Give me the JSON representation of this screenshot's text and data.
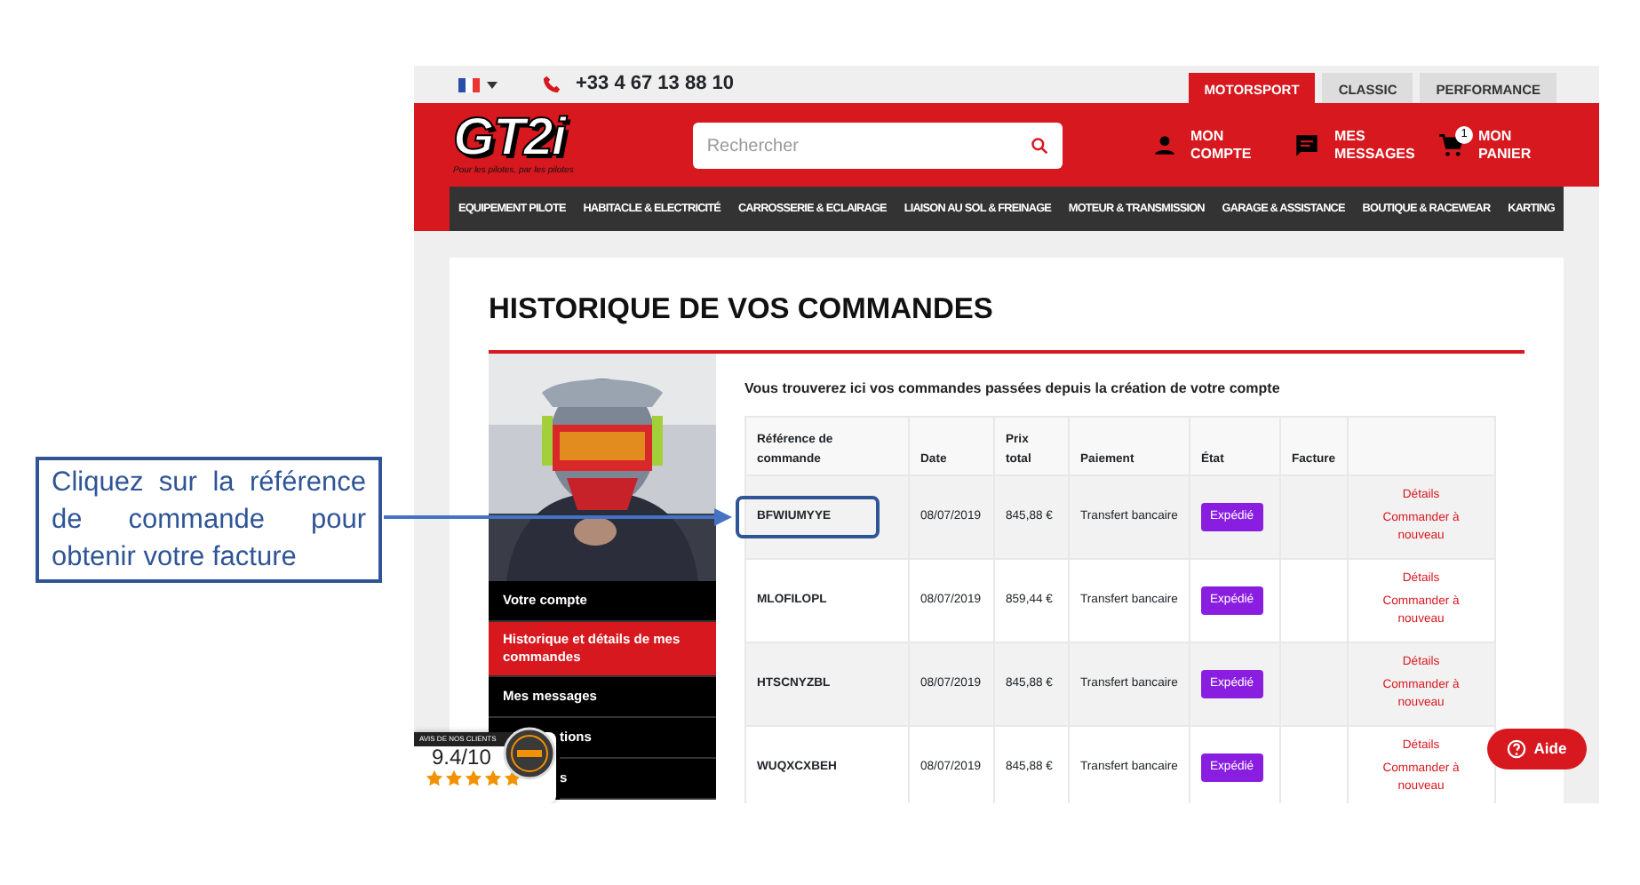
{
  "annotation": {
    "callout": "Cliquez sur la référence de commande pour obtenir votre facture"
  },
  "topbar": {
    "phone": "+33 4 67 13 88 10",
    "universes": [
      {
        "label": "MOTORSPORT",
        "selected": true
      },
      {
        "label": "CLASSIC",
        "selected": false
      },
      {
        "label": "PERFORMANCE",
        "selected": false
      }
    ]
  },
  "header": {
    "logo": "GT2i",
    "tagline": "Pour les pilotes, par les pilotes",
    "search": {
      "placeholder": "Rechercher"
    },
    "actions": [
      {
        "kind": "account",
        "label": "MON COMPTE"
      },
      {
        "kind": "messages",
        "label": "MES MESSAGES"
      },
      {
        "kind": "cart",
        "label": "MON PANIER",
        "badge": "1"
      }
    ]
  },
  "nav": [
    "EQUIPEMENT PILOTE",
    "HABITACLE & ELECTRICITÉ",
    "CARROSSERIE & ECLAIRAGE",
    "LIAISON AU SOL & FREINAGE",
    "MOTEUR & TRANSMISSION",
    "GARAGE & ASSISTANCE",
    "BOUTIQUE & RACEWEAR",
    "KARTING"
  ],
  "page": {
    "title": "HISTORIQUE DE VOS COMMANDES",
    "intro": "Vous trouverez ici vos commandes passées depuis la création de votre compte",
    "menu": [
      {
        "label": "Votre compte",
        "selected": false
      },
      {
        "label": "Historique et détails de mes commandes",
        "selected": true
      },
      {
        "label": "Mes messages",
        "selected": false
      },
      {
        "label": "tions",
        "selected": false
      },
      {
        "label": "s",
        "selected": false
      }
    ],
    "table": {
      "columns": [
        "Référence de commande",
        "Date",
        "Prix total",
        "Paiement",
        "État",
        "Facture"
      ],
      "rows": [
        {
          "reference": "BFWIUMYYE",
          "date": "08/07/2019",
          "total": "845,88 €",
          "payment": "Transfert bancaire",
          "status": "Expédié",
          "actions": [
            "Détails",
            "Commander à nouveau"
          ],
          "highlighted": true
        },
        {
          "reference": "MLOFILOPL",
          "date": "08/07/2019",
          "total": "859,44 €",
          "payment": "Transfert bancaire",
          "status": "Expédié",
          "actions": [
            "Détails",
            "Commander à nouveau"
          ],
          "highlighted": false
        },
        {
          "reference": "HTSCNYZBL",
          "date": "08/07/2019",
          "total": "845,88 €",
          "payment": "Transfert bancaire",
          "status": "Expédié",
          "actions": [
            "Détails",
            "Commander à nouveau"
          ],
          "highlighted": false
        },
        {
          "reference": "WUQXCXBEH",
          "date": "08/07/2019",
          "total": "845,88 €",
          "payment": "Transfert bancaire",
          "status": "Expédié",
          "actions": [
            "Détails",
            "Commander à nouveau"
          ],
          "highlighted": false
        }
      ]
    }
  },
  "review_badge": {
    "caption": "AVIS DE NOS CLIENTS",
    "score": "9.4/10",
    "stars": 5
  },
  "help_button": {
    "label": "Aide"
  }
}
